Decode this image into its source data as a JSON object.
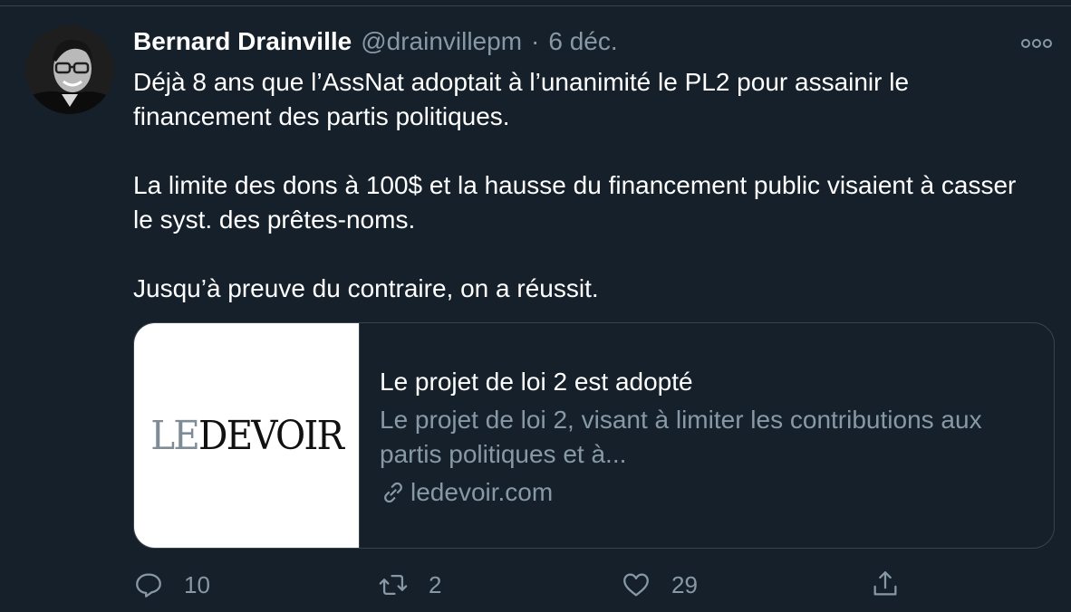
{
  "tweet": {
    "author_name": "Bernard Drainville",
    "author_handle": "@drainvillepm",
    "separator": "·",
    "date": "6 déc.",
    "paragraphs": [
      "Déjà 8 ans que l’AssNat adoptait à l’unanimité le PL2 pour assainir le financement des partis politiques.",
      "La limite des dons à 100$ et la hausse du financement public visaient à casser le syst. des prêtes-noms.",
      "Jusqu’à preuve du contraire, on a réussit."
    ]
  },
  "card": {
    "logo_le": "LE",
    "logo_devoir": "DEVOIR",
    "title": "Le projet de loi 2 est adopté",
    "description": "Le projet de loi 2, visant à limiter les contributions aux partis politiques et à...",
    "domain": "ledevoir.com"
  },
  "actions": {
    "replies": "10",
    "retweets": "2",
    "likes": "29"
  },
  "icons": {
    "more": "more-icon",
    "reply": "reply-icon",
    "retweet": "retweet-icon",
    "like": "heart-icon",
    "share": "share-icon",
    "link": "link-icon"
  },
  "colors": {
    "background": "#15202b",
    "secondary_text": "#8899a6",
    "border": "#38444d",
    "primary_text": "#ffffff"
  }
}
